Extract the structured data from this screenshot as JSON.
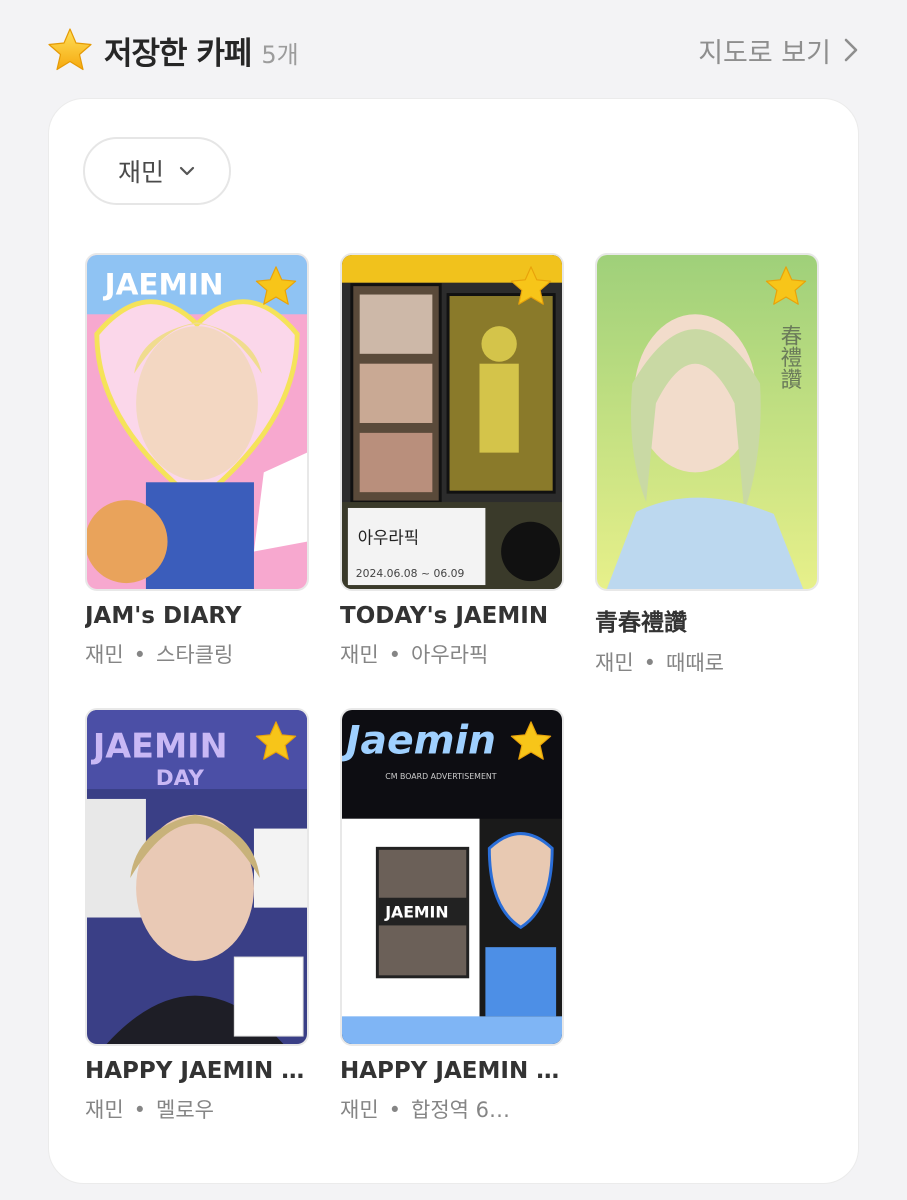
{
  "header": {
    "title": "저장한 카페",
    "count": "5개",
    "map_link": "지도로 보기"
  },
  "filter": {
    "label": "재민"
  },
  "cafes": [
    {
      "name": "JAM's DIARY",
      "member": "재민",
      "location": "스타클링",
      "photo_text": "JAEMIN"
    },
    {
      "name": "TODAY's JAEMIN",
      "member": "재민",
      "location": "아우라픽",
      "photo_text": "아우라픽",
      "photo_subtext": "2024.06.08 ~ 06.09"
    },
    {
      "name": "青春禮讚",
      "member": "재민",
      "location": "때때로",
      "photo_text": "春禮讚"
    },
    {
      "name": "HAPPY JAEMIN …",
      "member": "재민",
      "location": "멜로우",
      "photo_text": "JAEMIN",
      "photo_subtext": "DAY"
    },
    {
      "name": "HAPPY JAEMIN …",
      "member": "재민",
      "location": "합정역 6…",
      "photo_text": "Jaemin",
      "photo_subtext": "CM BOARD ADVERTISEMENT",
      "photo_tag": "JAEMIN"
    }
  ],
  "separator": "•",
  "colors": {
    "star": "#f7c519",
    "accent_pink": "#f59ac7",
    "accent_blue": "#6aa7f0"
  }
}
